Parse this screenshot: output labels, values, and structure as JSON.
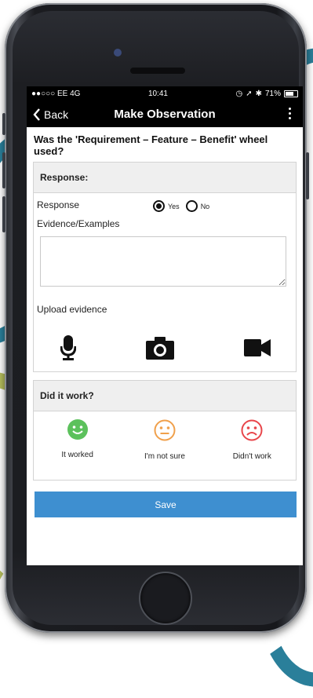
{
  "status_bar": {
    "carrier": "●●○○○ EE  4G",
    "time": "10:41",
    "battery": "71%"
  },
  "nav": {
    "back_label": "Back",
    "title": "Make Observation"
  },
  "question": "Was the 'Requirement – Feature – Benefit' wheel used?",
  "response_section": {
    "header": "Response:",
    "response_label": "Response",
    "options": [
      {
        "label": "Yes",
        "selected": true
      },
      {
        "label": "No",
        "selected": false
      }
    ],
    "evidence_label": "Evidence/Examples",
    "evidence_value": "",
    "upload_label": "Upload evidence",
    "upload_icons": [
      "microphone-icon",
      "camera-icon",
      "video-camera-icon"
    ]
  },
  "work_section": {
    "header": "Did it work?",
    "moods": [
      {
        "label": "It worked",
        "icon": "happy-face-icon",
        "color": "#5cc15c"
      },
      {
        "label": "I'm not sure",
        "icon": "neutral-face-icon",
        "color": "#f0a04b"
      },
      {
        "label": "Didn't work",
        "icon": "sad-face-icon",
        "color": "#e8454a"
      }
    ]
  },
  "save_label": "Save",
  "colors": {
    "accent": "#3e8fd0",
    "header_bg": "#000000",
    "section_bg": "#efefef"
  }
}
